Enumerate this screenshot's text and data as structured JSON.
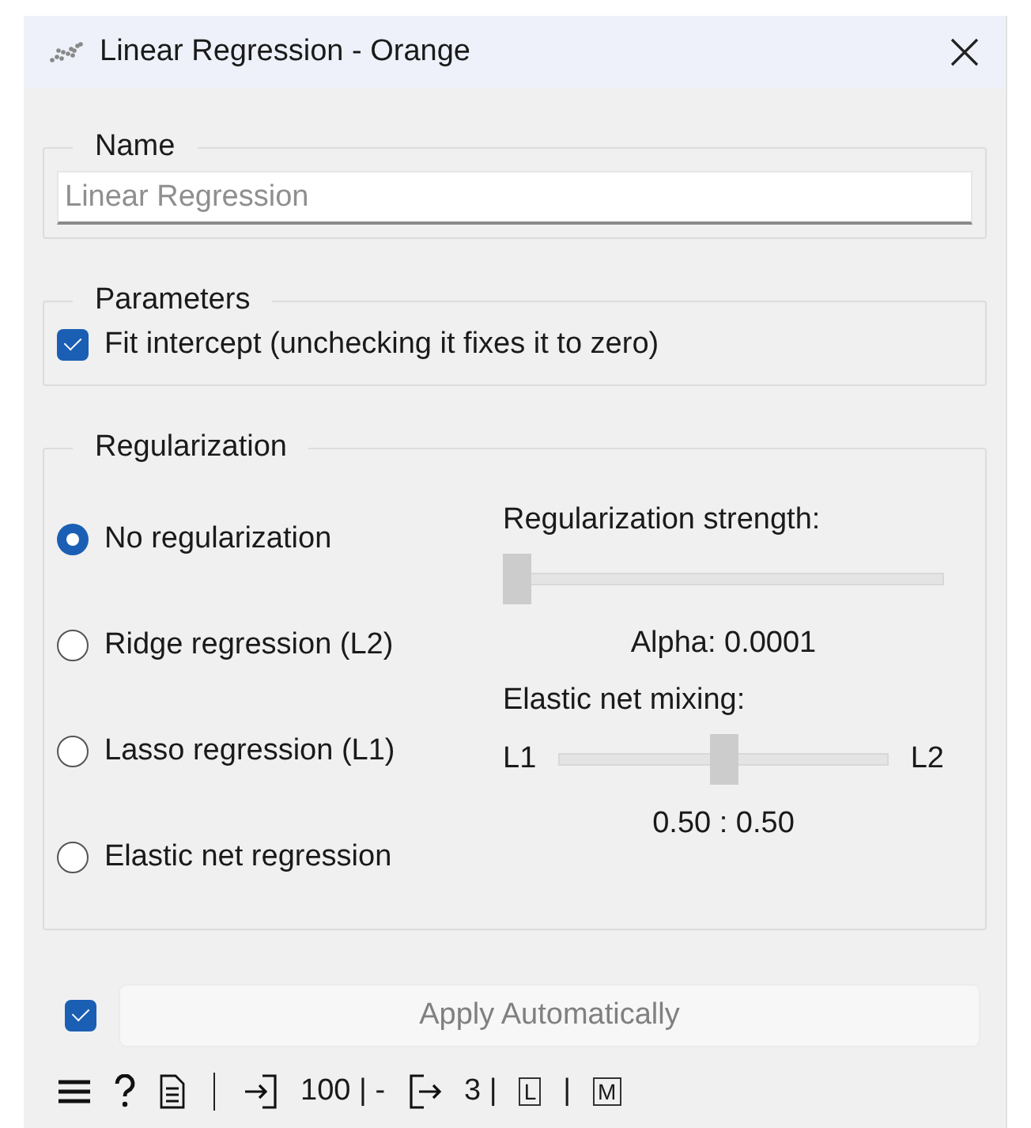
{
  "window": {
    "title": "Linear Regression - Orange"
  },
  "name_group": {
    "title": "Name",
    "field": {
      "placeholder": "Linear Regression"
    }
  },
  "parameters_group": {
    "title": "Parameters",
    "options": [
      {
        "label": "Fit intercept (unchecking it fixes it to zero)",
        "checked": true
      }
    ]
  },
  "regularization_group": {
    "title": "Regularization",
    "methods": [
      {
        "label": "No regularization",
        "selected": true
      },
      {
        "label": "Ridge regression (L2)",
        "selected": false
      },
      {
        "label": "Lasso regression (L1)",
        "selected": false
      },
      {
        "label": "Elastic net regression",
        "selected": false
      }
    ],
    "strength": {
      "label": "Regularization strength:",
      "level": 0,
      "disabled": true,
      "reading": "Alpha: 0.0001"
    },
    "mixing": {
      "label": "Elastic net mixing:",
      "left": "L1",
      "right": "L2",
      "level": 0.5,
      "disabled": true,
      "reading": "0.50 : 0.50"
    }
  },
  "apply": {
    "checked": true,
    "label": "Apply Automatically"
  },
  "status_bar": {
    "input_count": "100 | -",
    "output_count": "3 |",
    "separator": "|",
    "badges": [
      "L",
      "M"
    ]
  }
}
